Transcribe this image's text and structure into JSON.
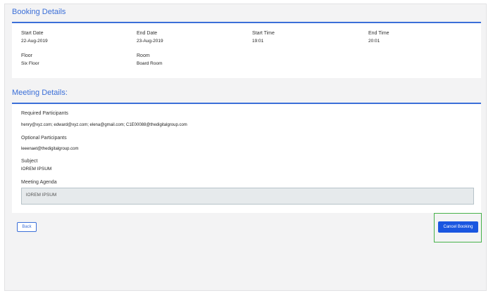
{
  "booking_details": {
    "title": "Booking Details",
    "start_date": {
      "label": "Start Date",
      "value": "22-Aug-2019"
    },
    "end_date": {
      "label": "End Date",
      "value": "23-Aug-2019"
    },
    "start_time": {
      "label": "Start Time",
      "value": "19:01"
    },
    "end_time": {
      "label": "End Time",
      "value": "20:01"
    },
    "floor": {
      "label": "Floor",
      "value": "Six Floor"
    },
    "room": {
      "label": "Room",
      "value": "Board Room"
    }
  },
  "meeting_details": {
    "title": "Meeting Details:",
    "required_participants": {
      "label": "Required Participants",
      "value": "henry@xyz.com; edward@xyz.com; elena@gmail.com; C1E00088@thedigitalgroup.com"
    },
    "optional_participants": {
      "label": "Optional Participants",
      "value": "leeenaet@thedigitalgroup.com"
    },
    "subject": {
      "label": "Subject",
      "value": "lOREM IPSUM"
    },
    "meeting_agenda": {
      "label": "Meeting Agenda",
      "value": "lOREM IPSUM"
    }
  },
  "actions": {
    "back_label": "Back",
    "cancel_booking_label": "Cancel Booking"
  },
  "colors": {
    "accent": "#3b6fd8",
    "primary_button": "#1a56e0",
    "highlight": "#47b24a"
  }
}
